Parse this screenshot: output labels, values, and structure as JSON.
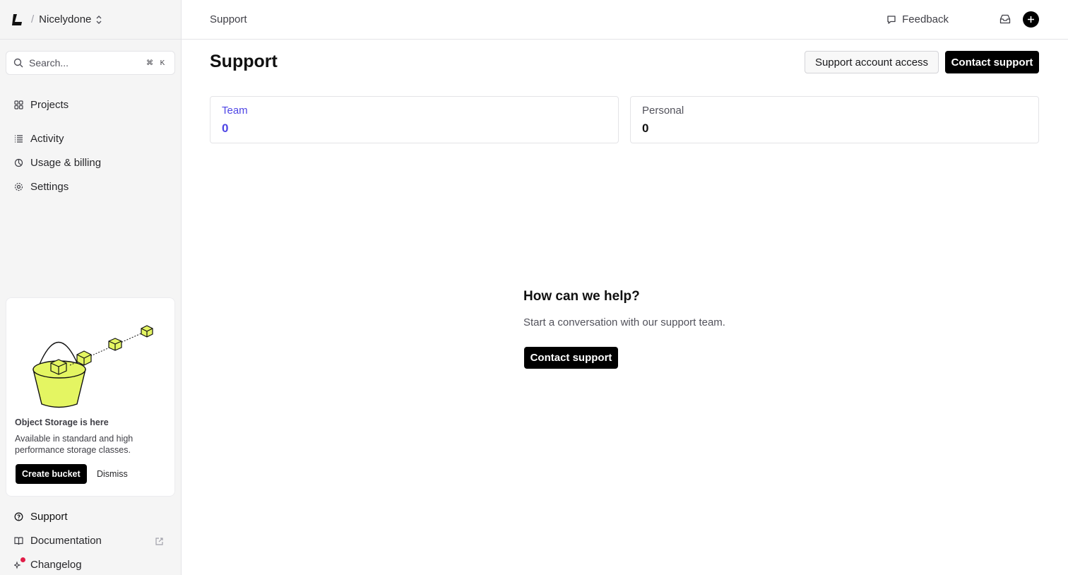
{
  "header": {
    "team_name": "Nicelydone",
    "breadcrumb": "Support",
    "feedback_label": "Feedback"
  },
  "search": {
    "placeholder": "Search...",
    "shortcut_key_1": "⌘",
    "shortcut_key_2": "K"
  },
  "sidebar": {
    "items": [
      {
        "label": "Projects",
        "icon": "grid-icon"
      },
      {
        "label": "Activity",
        "icon": "list-icon"
      },
      {
        "label": "Usage & billing",
        "icon": "billing-icon"
      },
      {
        "label": "Settings",
        "icon": "gear-icon"
      }
    ],
    "bottom_items": [
      {
        "label": "Support",
        "icon": "help-circle-icon"
      },
      {
        "label": "Documentation",
        "icon": "book-icon"
      },
      {
        "label": "Changelog",
        "icon": "sparkle-icon"
      }
    ]
  },
  "promo": {
    "title": "Object Storage is here",
    "description": "Available in standard and high performance storage classes.",
    "primary_label": "Create bucket",
    "secondary_label": "Dismiss",
    "accent_color": "#e4f562"
  },
  "page": {
    "title": "Support",
    "secondary_button": "Support account access",
    "primary_button": "Contact support"
  },
  "tabs": [
    {
      "label": "Team",
      "count": "0",
      "active": true
    },
    {
      "label": "Personal",
      "count": "0",
      "active": false
    }
  ],
  "empty_state": {
    "title": "How can we help?",
    "subtitle": "Start a conversation with our support team.",
    "button": "Contact support"
  },
  "colors": {
    "accent": "#4f46e5",
    "notification_dot": "#e11d48"
  }
}
